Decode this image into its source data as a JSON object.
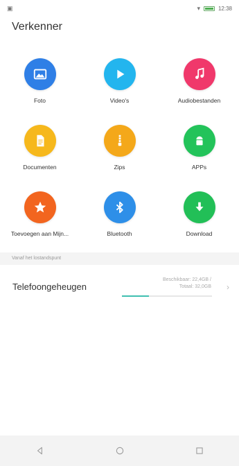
{
  "status_bar": {
    "time": "12:38"
  },
  "header": {
    "title": "Verkenner"
  },
  "categories": [
    {
      "label": "Foto",
      "color": "#2f7fe6",
      "icon": "image-icon"
    },
    {
      "label": "Video's",
      "color": "#23b5ee",
      "icon": "play-icon"
    },
    {
      "label": "Audiobestanden",
      "color": "#f0386b",
      "icon": "music-note-icon"
    },
    {
      "label": "Documenten",
      "color": "#f6b81c",
      "icon": "document-icon"
    },
    {
      "label": "Zips",
      "color": "#f4a81a",
      "icon": "zip-icon"
    },
    {
      "label": "APPs",
      "color": "#23c35a",
      "icon": "android-icon"
    },
    {
      "label": "Toevoegen aan Mijn...",
      "color": "#f2651f",
      "icon": "star-icon"
    },
    {
      "label": "Bluetooth",
      "color": "#2e8fe8",
      "icon": "bluetooth-icon"
    },
    {
      "label": "Download",
      "color": "#22bf57",
      "icon": "download-icon"
    }
  ],
  "storage_section": {
    "header": "Vanaf het lostandspunt",
    "name": "Telefoongeheugen",
    "available": "Beschikbaar: 22,4GB /",
    "total": "Totaal: 32,0GB",
    "used_fraction": 0.3
  },
  "navbar": {
    "back": "back-icon",
    "home": "home-icon",
    "recents": "recents-icon"
  }
}
